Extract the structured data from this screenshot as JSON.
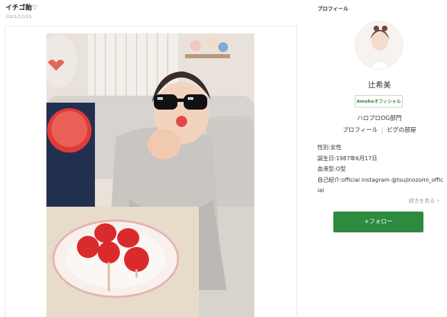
{
  "post": {
    "title": "イチゴ飴♡",
    "date": "2021/11/23"
  },
  "profile": {
    "heading": "プロフィール",
    "name": "辻希美",
    "badge": "Amebaオフィシャル",
    "group": "ハロプロOG部門",
    "links": [
      "プロフィール",
      "ピグの部屋"
    ],
    "info": {
      "gender": "性別:女性",
      "birthday": "誕生日:1987年6月17日",
      "blood_type": "血液型:O型",
      "bio": "自己紹介:official instagram @tsujinozomi_official"
    },
    "read_more": "続きを見る",
    "follow_label": "+フォロー"
  },
  "colors": {
    "accent_green": "#2d8a3e",
    "badge_green": "#3a8a3a"
  }
}
